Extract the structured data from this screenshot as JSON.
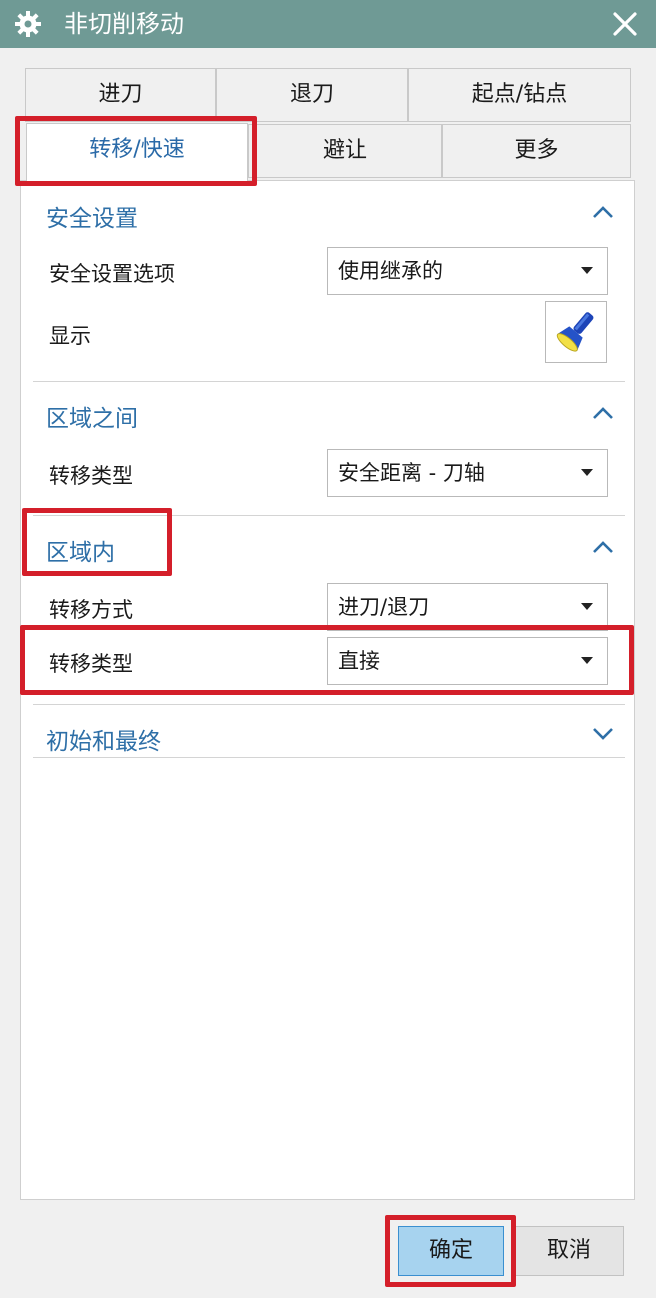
{
  "window": {
    "title": "非切削移动"
  },
  "tabs_row1": [
    "进刀",
    "退刀",
    "起点/钻点"
  ],
  "tabs_row2": [
    "转移/快速",
    "避让",
    "更多"
  ],
  "sections": {
    "safety": {
      "title": "安全设置",
      "option_label": "安全设置选项",
      "option_value": "使用继承的",
      "display_label": "显示"
    },
    "between_regions": {
      "title": "区域之间",
      "transfer_type_label": "转移类型",
      "transfer_type_value": "安全距离 - 刀轴"
    },
    "within_region": {
      "title": "区域内",
      "transfer_method_label": "转移方式",
      "transfer_method_value": "进刀/退刀",
      "transfer_type_label": "转移类型",
      "transfer_type_value": "直接"
    },
    "initial_final": {
      "title": "初始和最终"
    }
  },
  "buttons": {
    "ok": "确定",
    "cancel": "取消"
  },
  "colors": {
    "titlebar": "#6f9a95",
    "section_title": "#2e6fa7",
    "highlight_box": "#d41f2a",
    "ok_button": "#a7d3ef"
  },
  "icons": [
    "gear-icon",
    "close-icon",
    "chevron-up-icon",
    "chevron-down-icon",
    "flashlight-icon"
  ]
}
